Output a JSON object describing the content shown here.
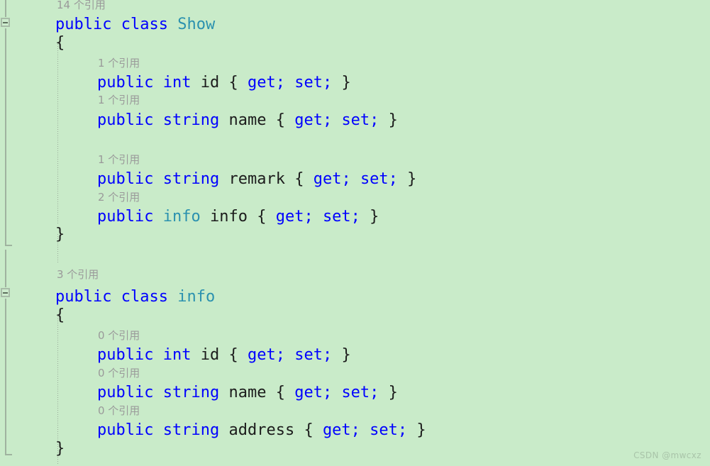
{
  "editor": {
    "background_color": "#c9ebc9",
    "keyword_color": "#0000ff",
    "type_color": "#2b91af",
    "identifier_color": "#1c1c1c",
    "codelens_color": "#9a9a9a",
    "language": "csharp"
  },
  "codelens": {
    "show_class": "14 个引用",
    "show_id": "1 个引用",
    "show_name": "1 个引用",
    "show_remark": "1 个引用",
    "show_info": "2 个引用",
    "info_class": "3 个引用",
    "info_id": "0 个引用",
    "info_name": "0 个引用",
    "info_address": "0 个引用"
  },
  "code": {
    "show_class_decl": {
      "kw_public": "public",
      "kw_class": "class",
      "name": "Show"
    },
    "open_brace": "{",
    "close_brace": "}",
    "show_id": {
      "kw_public": "public",
      "kw_type": "int",
      "name": "id",
      "accessors": "{ get; set; }"
    },
    "show_name": {
      "kw_public": "public",
      "kw_type": "string",
      "name": "name",
      "accessors": "{ get; set; }"
    },
    "show_remark": {
      "kw_public": "public",
      "kw_type": "string",
      "name": "remark",
      "accessors": "{ get; set; }"
    },
    "show_info": {
      "kw_public": "public",
      "kw_type": "info",
      "name": "info",
      "accessors": "{ get; set; }"
    },
    "info_class_decl": {
      "kw_public": "public",
      "kw_class": "class",
      "name": "info"
    },
    "info_id": {
      "kw_public": "public",
      "kw_type": "int",
      "name": "id",
      "accessors": "{ get; set; }"
    },
    "info_name": {
      "kw_public": "public",
      "kw_type": "string",
      "name": "name",
      "accessors": "{ get; set; }"
    },
    "info_address": {
      "kw_public": "public",
      "kw_type": "string",
      "name": "address",
      "accessors": "{ get; set; }"
    }
  },
  "accessor_tokens": {
    "open": "{",
    "get": "get;",
    "set": "set;",
    "close": "}"
  },
  "watermark": {
    "text": "CSDN @mwcxz"
  }
}
